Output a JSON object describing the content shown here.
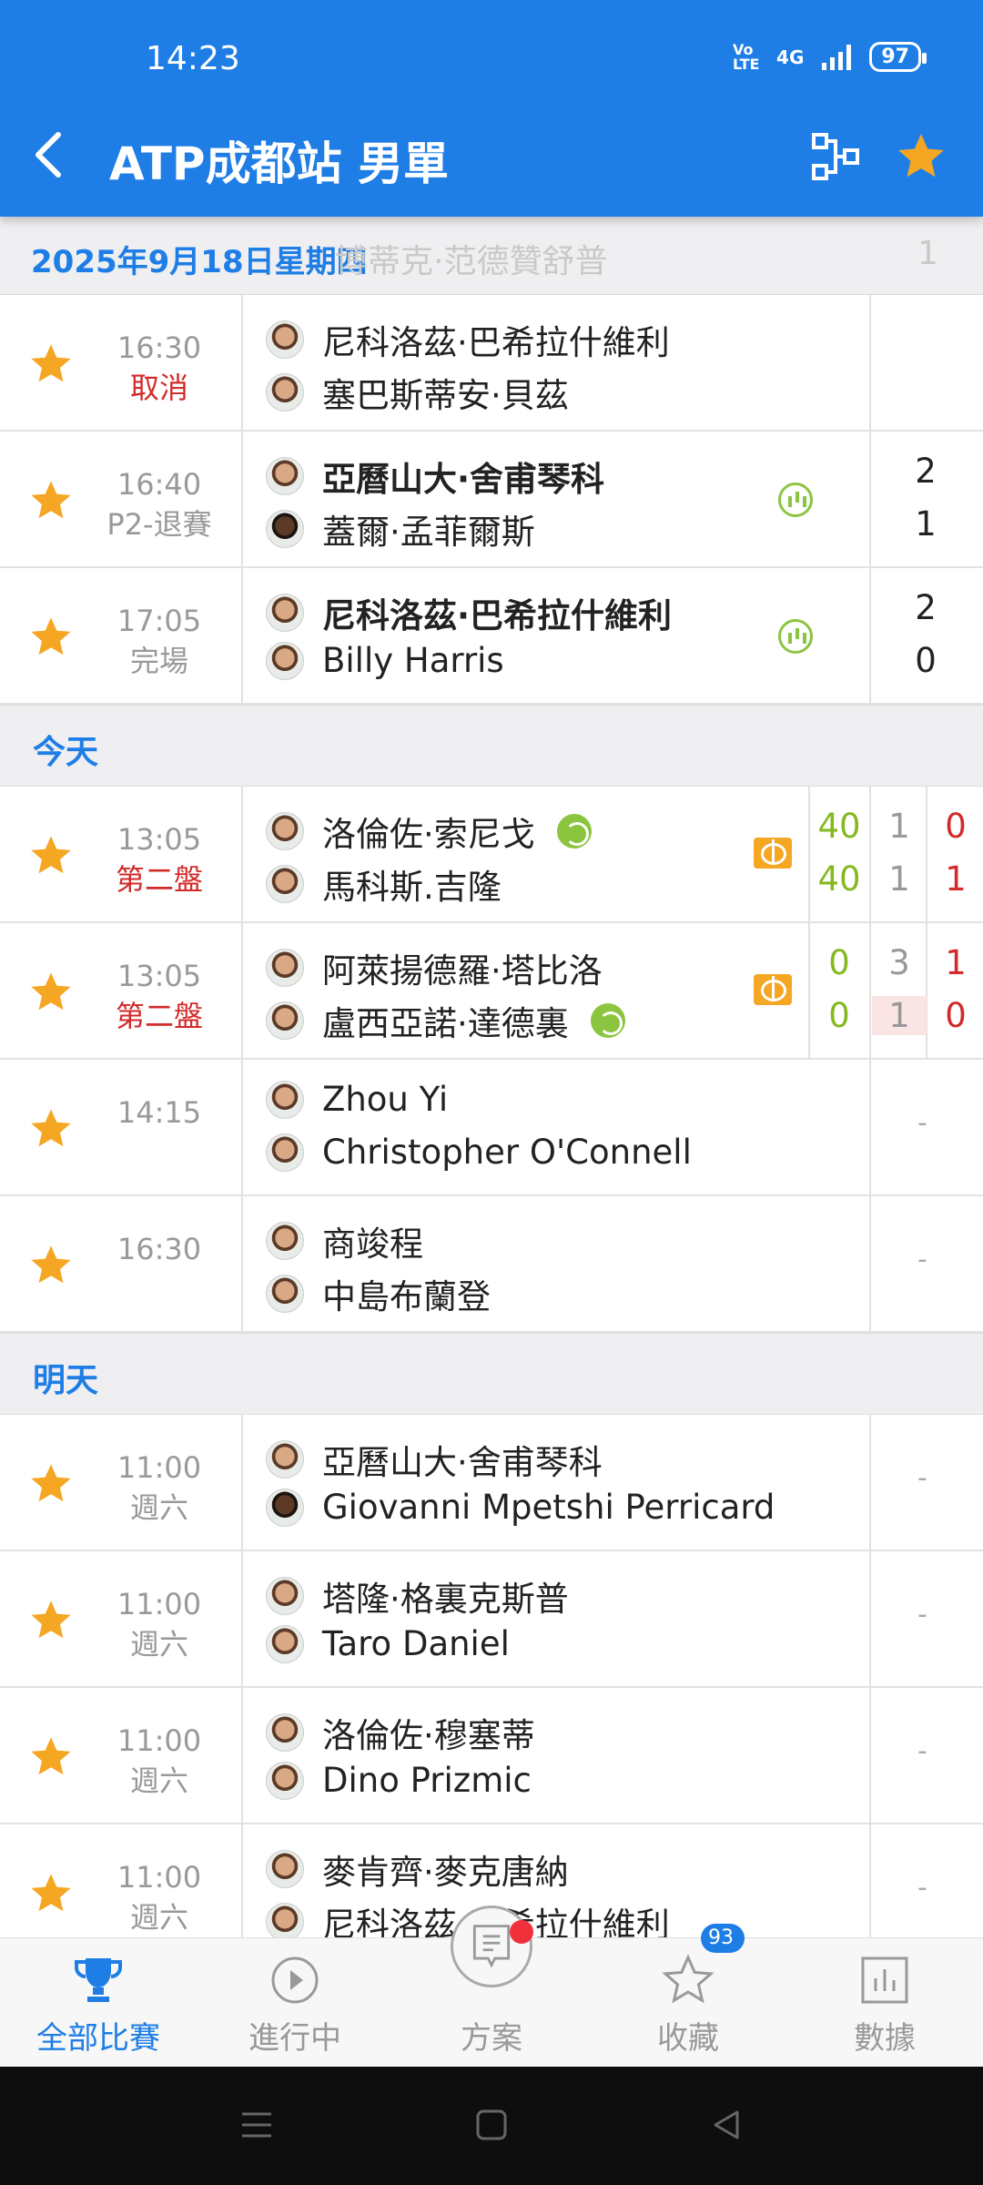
{
  "status_bar": {
    "time": "14:23",
    "network": "4G",
    "volte": "Vo LTE",
    "battery": "97"
  },
  "header": {
    "title": "ATP成都站 男單"
  },
  "list": {
    "partial_row_text": "博蒂克·范德贊舒普",
    "partial_row_score": "1",
    "date_header": "2025年9月18日星期四",
    "groups": [
      {
        "label": "",
        "matches": [
          {
            "time": "16:30",
            "status": "取消",
            "status_color": "red",
            "p1": "尼科洛茲·巴希拉什維利",
            "p2": "塞巴斯蒂安·貝茲"
          },
          {
            "time": "16:40",
            "status": "P2-退賽",
            "status_color": "grey",
            "p1": "亞曆山大·舍甫琴科",
            "p2": "蓋爾·孟菲爾斯",
            "s1": "2",
            "s2": "1"
          },
          {
            "time": "17:05",
            "status": "完場",
            "status_color": "grey",
            "p1": "尼科洛茲·巴希拉什維利",
            "p2": "Billy Harris",
            "s1": "2",
            "s2": "0"
          }
        ]
      },
      {
        "label": "今天",
        "matches": [
          {
            "time": "13:05",
            "status": "第二盤",
            "p1": "洛倫佐·索尼戈",
            "p2": "馬科斯.吉隆",
            "pts1": "40",
            "pts2": "40",
            "g1a": "1",
            "g1b": "1",
            "g2a": "0",
            "g2b": "1"
          },
          {
            "time": "13:05",
            "status": "第二盤",
            "p1": "阿萊揚德羅·塔比洛",
            "p2": "盧西亞諾·達德裏",
            "pts1": "0",
            "pts2": "0",
            "g1a": "3",
            "g1b": "1",
            "g2a": "1",
            "g2b": "0"
          },
          {
            "time": "14:15",
            "p1": "Zhou Yi",
            "p2": "Christopher O'Connell",
            "score": "-"
          },
          {
            "time": "16:30",
            "p1": "商竣程",
            "p2": "中島布蘭登",
            "score": "-"
          }
        ]
      },
      {
        "label": "明天",
        "matches": [
          {
            "time": "11:00",
            "day": "週六",
            "p1": "亞曆山大·舍甫琴科",
            "p2": "Giovanni Mpetshi Perricard",
            "score": "-"
          },
          {
            "time": "11:00",
            "day": "週六",
            "p1": "塔隆·格裏克斯普",
            "p2": "Taro Daniel",
            "score": "-"
          },
          {
            "time": "11:00",
            "day": "週六",
            "p1": "洛倫佐·穆塞蒂",
            "p2": "Dino Prizmic",
            "score": "-"
          },
          {
            "time": "11:00",
            "day": "週六",
            "p1": "麥肯齊·麥克唐納",
            "p2": "尼科洛茲·巴希拉什維利",
            "score": "-"
          }
        ]
      }
    ]
  },
  "bottom_nav": {
    "items": [
      {
        "label": "全部比賽",
        "icon": "trophy-icon"
      },
      {
        "label": "進行中",
        "icon": "play-icon"
      },
      {
        "label": "方案",
        "icon": "plan-icon"
      },
      {
        "label": "收藏",
        "icon": "star-icon",
        "badge": "93"
      },
      {
        "label": "數據",
        "icon": "chart-icon"
      }
    ]
  },
  "colors": {
    "primary": "#1e7ee6",
    "star": "#f5a623",
    "green": "#86b822",
    "red": "#d32a2a"
  }
}
